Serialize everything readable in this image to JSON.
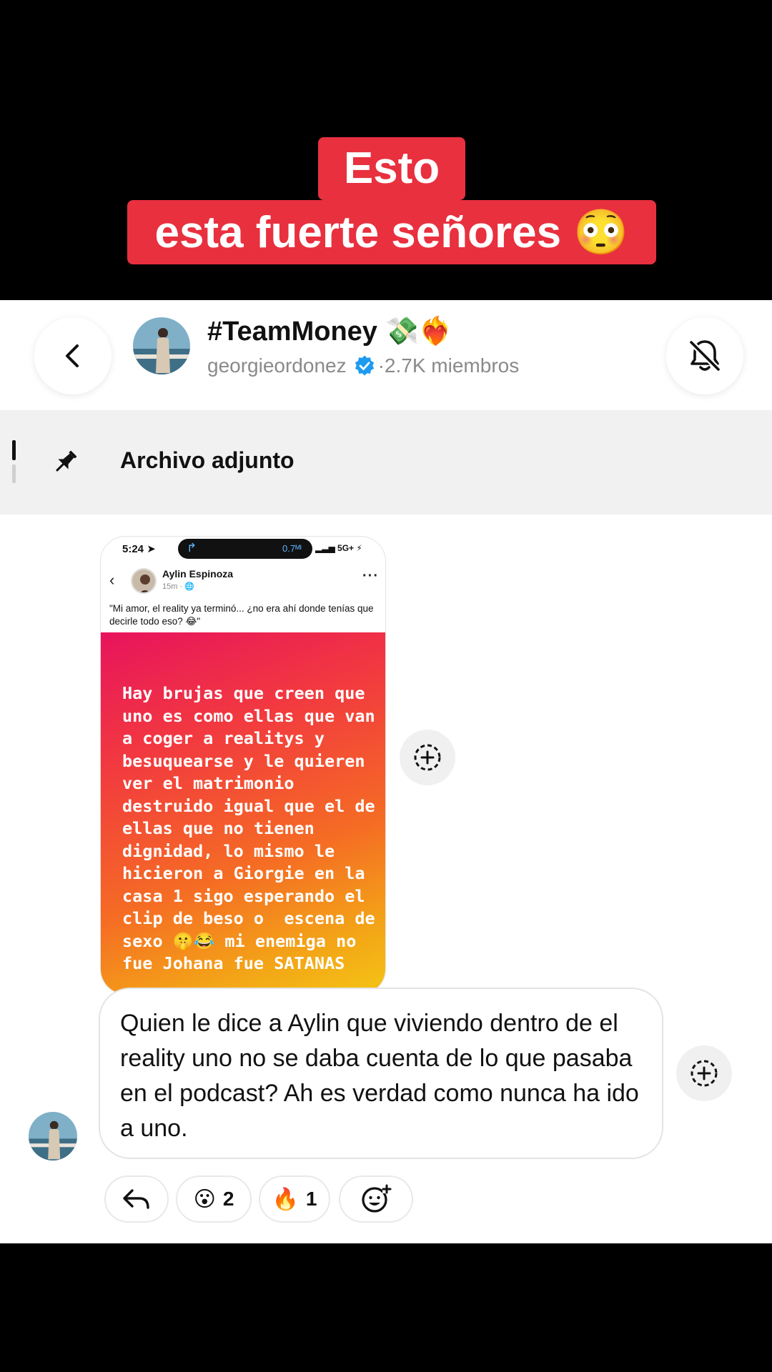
{
  "caption": {
    "line1": "Esto",
    "line2": "esta fuerte señores 😳"
  },
  "header": {
    "title": "#TeamMoney 💸❤️‍🔥",
    "owner": "georgieordonez",
    "separator": "·",
    "members": "2.7K miembros"
  },
  "pinned": {
    "label": "Archivo adjunto"
  },
  "shared_post": {
    "status_time": "5:24",
    "speed": "0.7ᴹᴵ",
    "network": "5G+",
    "author": "Aylin Espinoza",
    "meta": "15m · 🌐",
    "caption": "\"Mi amor, el reality ya terminó... ¿no era ahí donde tenías que decirle todo eso? 😂\"",
    "story_text": "Hay brujas que creen que\nuno es como ellas que van\na coger a realitys y\nbesuquearse y le quieren\nver el matrimonio\ndestruido igual que el de\nellas que no tienen\ndignidad, lo mismo le\nhicieron a Giorgie en la\ncasa 1 sigo esperando el\nclip de beso o  escena de\nsexo 🤫😂 mi enemiga no\nfue Johana fue SATANAS"
  },
  "message": {
    "text": "Quien le dice a Aylin que viviendo dentro de el reality uno no se daba cuenta de lo que pasaba en el podcast? Ah es verdad como nunca ha ido a uno."
  },
  "reactions": [
    {
      "emoji": "😮",
      "count": "2"
    },
    {
      "emoji": "🔥",
      "count": "1"
    }
  ],
  "colors": {
    "caption_bg": "#e8303f",
    "verified": "#1d9bf0",
    "story_gradient_start": "#e8135d",
    "story_gradient_end": "#f4c514"
  }
}
